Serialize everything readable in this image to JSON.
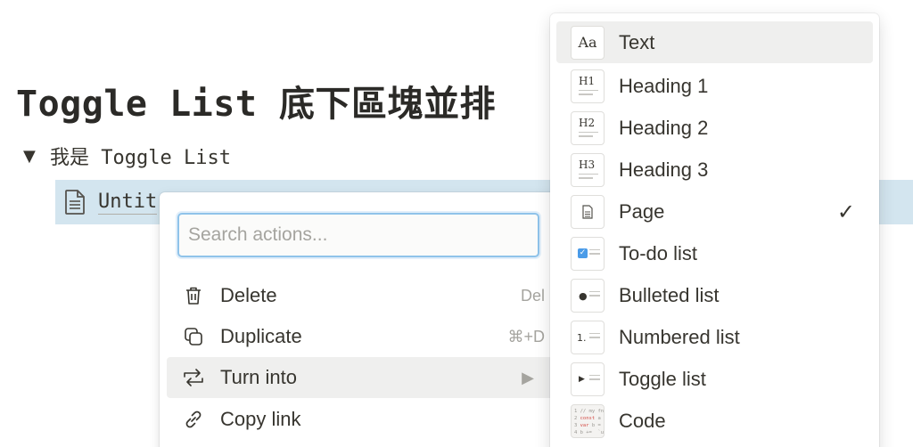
{
  "page": {
    "title": "Toggle List 底下區塊並排",
    "toggle_label": "我是 Toggle List",
    "child_page_title": "Untit"
  },
  "context_menu": {
    "search_placeholder": "Search actions...",
    "items": [
      {
        "label": "Delete",
        "shortcut": "Del",
        "icon": "trash-icon"
      },
      {
        "label": "Duplicate",
        "shortcut": "⌘+D",
        "icon": "duplicate-icon"
      },
      {
        "label": "Turn into",
        "shortcut": "▶",
        "icon": "turn-into-icon",
        "highlighted": true
      },
      {
        "label": "Copy link",
        "shortcut": "",
        "icon": "link-icon"
      }
    ]
  },
  "turn_into_menu": {
    "items": [
      {
        "label": "Text",
        "icon": "text-icon",
        "tile_text": "Aa",
        "highlighted": true
      },
      {
        "label": "Heading 1",
        "icon": "heading-1-icon",
        "tile_text": "H1"
      },
      {
        "label": "Heading 2",
        "icon": "heading-2-icon",
        "tile_text": "H2"
      },
      {
        "label": "Heading 3",
        "icon": "heading-3-icon",
        "tile_text": "H3"
      },
      {
        "label": "Page",
        "icon": "page-icon",
        "selected": true
      },
      {
        "label": "To-do list",
        "icon": "todo-icon"
      },
      {
        "label": "Bulleted list",
        "icon": "bulleted-list-icon"
      },
      {
        "label": "Numbered list",
        "icon": "numbered-list-icon",
        "tile_text": "1."
      },
      {
        "label": "Toggle list",
        "icon": "toggle-list-icon"
      },
      {
        "label": "Code",
        "icon": "code-icon"
      }
    ],
    "selected_mark": "✓"
  },
  "colors": {
    "selected_block_bg": "#d3e5ef",
    "menu_hover_bg": "#efefee",
    "search_focus_border": "#8fc3ea",
    "todo_check": "#4a9be8"
  }
}
